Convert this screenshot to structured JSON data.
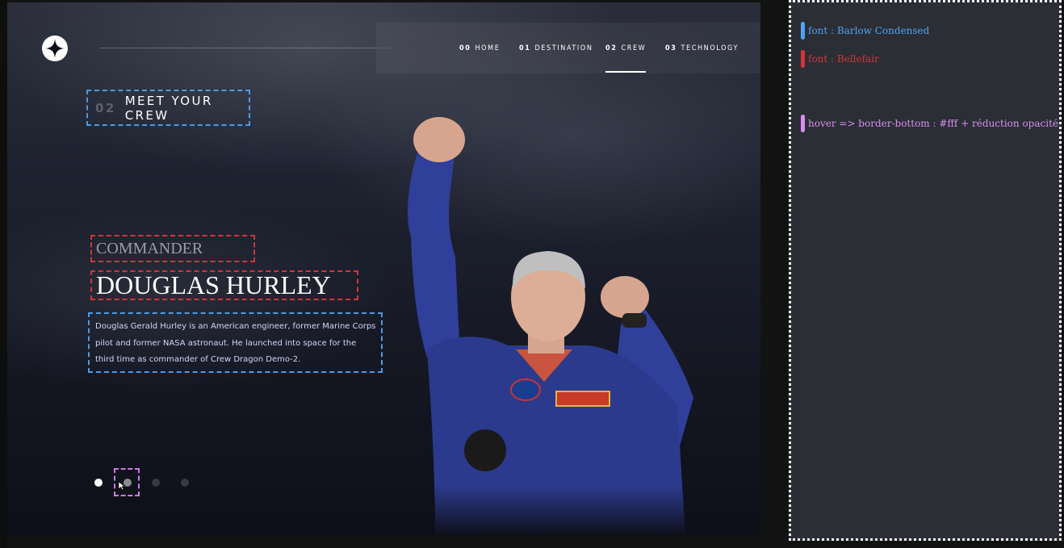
{
  "nav": {
    "items": [
      {
        "num": "00",
        "label": "HOME",
        "active": false
      },
      {
        "num": "01",
        "label": "DESTINATION",
        "active": false
      },
      {
        "num": "02",
        "label": "CREW",
        "active": true
      },
      {
        "num": "03",
        "label": "TECHNOLOGY",
        "active": false
      }
    ]
  },
  "heading": {
    "num": "02",
    "text": "MEET YOUR CREW"
  },
  "crew": {
    "role": "COMMANDER",
    "name": "DOUGLAS HURLEY",
    "bio": "Douglas Gerald Hurley is an American engineer, former Marine Corps pilot and former NASA astronaut. He launched into space for the third time as commander of Crew Dragon Demo-2."
  },
  "slider": {
    "count": 4,
    "active_index": 0,
    "hovered_index": 1
  },
  "annotations": [
    {
      "text": "font : Barlow Condensed",
      "color": "#4ea3f1"
    },
    {
      "text": "font : Bellefair",
      "color": "#d3343c"
    },
    {
      "text": "hover => border-bottom : #fff + réduction opacité",
      "color": "#d98ff0"
    }
  ],
  "colors": {
    "accent_white": "#ffffff",
    "bio_text": "#d0d6f9",
    "dark_bg": "#0b0d17"
  }
}
